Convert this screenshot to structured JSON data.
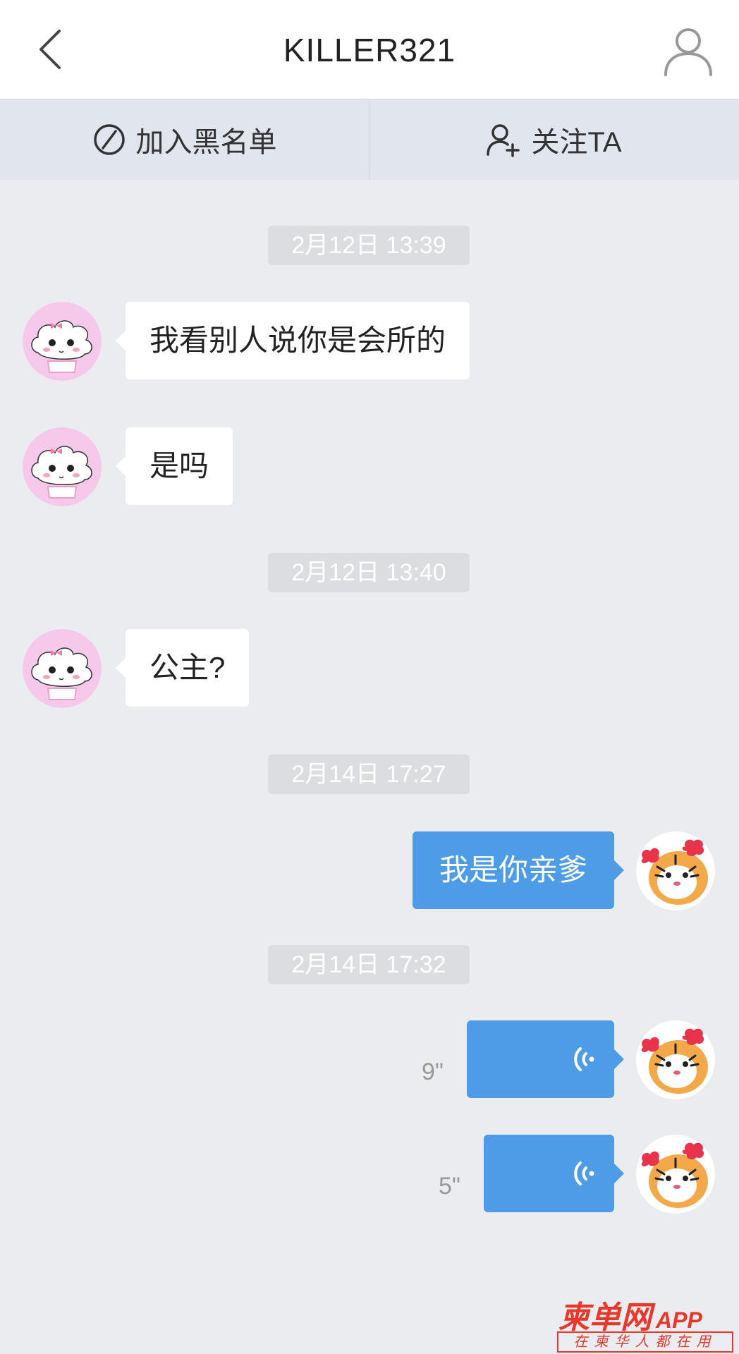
{
  "header": {
    "title": "KILLER321",
    "back_icon": "chevron-left-icon",
    "profile_icon": "person-outline-icon"
  },
  "actions": {
    "blacklist_label": "加入黑名单",
    "follow_label": "关注TA"
  },
  "conversation": {
    "timestamps": [
      "2月12日 13:39",
      "2月12日 13:40",
      "2月14日 17:27",
      "2月14日 17:32"
    ],
    "messages": [
      {
        "side": "incoming",
        "type": "text",
        "text": "我看别人说你是会所的"
      },
      {
        "side": "incoming",
        "type": "text",
        "text": "是吗"
      },
      {
        "side": "incoming",
        "type": "text",
        "text": "公主?"
      },
      {
        "side": "outgoing",
        "type": "text",
        "text": "我是你亲爹"
      },
      {
        "side": "outgoing",
        "type": "voice",
        "duration": "9\""
      },
      {
        "side": "outgoing",
        "type": "voice",
        "duration": "5\""
      }
    ]
  },
  "watermark": {
    "brand": "柬单网",
    "brand_suffix": "APP",
    "slogan": "在柬华人都在用"
  },
  "colors": {
    "outgoing_bubble": "#4e9ce8",
    "incoming_bubble": "#ffffff",
    "background": "#eaecf0",
    "action_bar": "#e1e5ee",
    "watermark": "#e8382b"
  }
}
